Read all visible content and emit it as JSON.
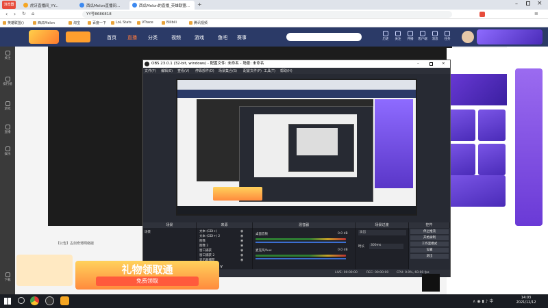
{
  "browser": {
    "brand_label": "浏览器",
    "tabs": [
      {
        "label": "虎牙直播间_YY...",
        "color": "#f5a623"
      },
      {
        "label": "西瓜Melon直播间...",
        "color": "#3c89f0"
      },
      {
        "label": "西瓜Melon的直播_英雄联盟...",
        "color": "#3c89f0"
      }
    ],
    "url": "YY号8686818",
    "bookmarks": [
      "英雄联盟()",
      "西瓜Melon",
      "淘宝",
      "百度一下",
      "LoL Stats",
      "VTrace",
      "Bilibili",
      "腾讯视频"
    ]
  },
  "site": {
    "nav": [
      "首页",
      "直播",
      "分类",
      "视频",
      "游戏",
      "鱼吧",
      "赛事"
    ],
    "top_icons": [
      "历史",
      "关注",
      "开播",
      "客户端",
      "消息",
      "任务"
    ]
  },
  "left_rail": [
    "关注",
    "排行榜",
    "游戏",
    "直播",
    "娱乐",
    "下载"
  ],
  "obs": {
    "title": "OBS 23.0.1 (32-bit, windows) - 配置文件: 未命名 - 场景: 未命名",
    "menu": [
      "文件(F)",
      "编辑(E)",
      "查看(V)",
      "停靠部件(D)",
      "场景集合(S)",
      "配置文件(P)",
      "工具(T)",
      "帮助(H)"
    ],
    "docks": {
      "scenes": {
        "title": "场景",
        "items": [
          "场景"
        ]
      },
      "sources": {
        "title": "来源",
        "items": [
          "文本 (GDI+)",
          "文本 (GDI+) 2",
          "图像",
          "图像 2",
          "窗口捕获",
          "窗口捕获 2",
          "显示器捕获"
        ]
      },
      "mixer": {
        "title": "混音器",
        "channels": [
          {
            "name": "桌面音频",
            "db": "0.0 dB",
            "level": 0.85
          },
          {
            "name": "麦克风/Aux",
            "db": "0.0 dB",
            "level": 0.6
          }
        ]
      },
      "transitions": {
        "title": "场景过渡",
        "type": "淡出",
        "duration_label": "时长",
        "duration": "300ms"
      },
      "controls": {
        "title": "控件",
        "buttons": [
          "停止推流",
          "开始录制",
          "工作室模式",
          "设置",
          "退出"
        ]
      }
    },
    "status": {
      "live": "LIVE: 00:00:00",
      "rec": "REC: 00:00:00",
      "cpu": "CPU: 0.0%, 60.00 fps"
    }
  },
  "overlay": {
    "gift_text": "礼物领取通",
    "gift_sub": "免费领取",
    "chat_tip": "【公告】古剑奇谭网络版"
  },
  "taskbar": {
    "time": "14:03",
    "date": "2021/12/12"
  },
  "colors": {
    "site_header": "#2b3a67",
    "promo_purple": "#6a3ad6",
    "gift_orange": "#ff8a3d"
  }
}
